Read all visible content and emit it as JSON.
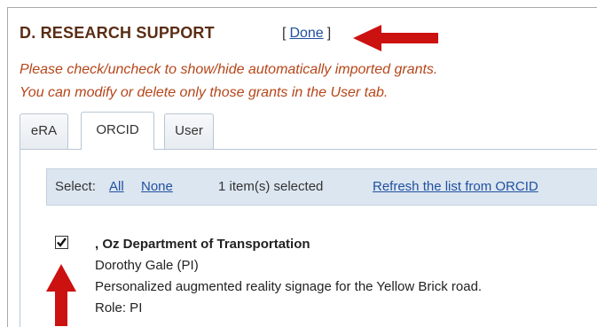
{
  "section": {
    "title": "D. RESEARCH SUPPORT",
    "done_label": "Done",
    "bracket_open": "[",
    "bracket_close": "]"
  },
  "instructions": {
    "line1": "Please check/uncheck to show/hide automatically imported grants.",
    "line2": "You can modify or delete only those grants in the User tab."
  },
  "tabs": [
    {
      "label": "eRA",
      "active": false
    },
    {
      "label": "ORCID",
      "active": true
    },
    {
      "label": "User",
      "active": false
    }
  ],
  "toolbar": {
    "select_label": "Select:",
    "all_label": "All",
    "none_label": "None",
    "selected_count": "1 item(s) selected",
    "refresh_label": "Refresh the list from ORCID"
  },
  "grant": {
    "checked": true,
    "agency": ", Oz Department of Transportation",
    "investigator": "Dorothy Gale (PI)",
    "title": "Personalized augmented reality signage for the Yellow Brick road.",
    "role": "Role: PI"
  },
  "colors": {
    "title": "#5a2d14",
    "instructions": "#b5461a",
    "link": "#2050a0",
    "toolbar_bg": "#dce6f0",
    "annotation_arrow": "#cc1111"
  }
}
